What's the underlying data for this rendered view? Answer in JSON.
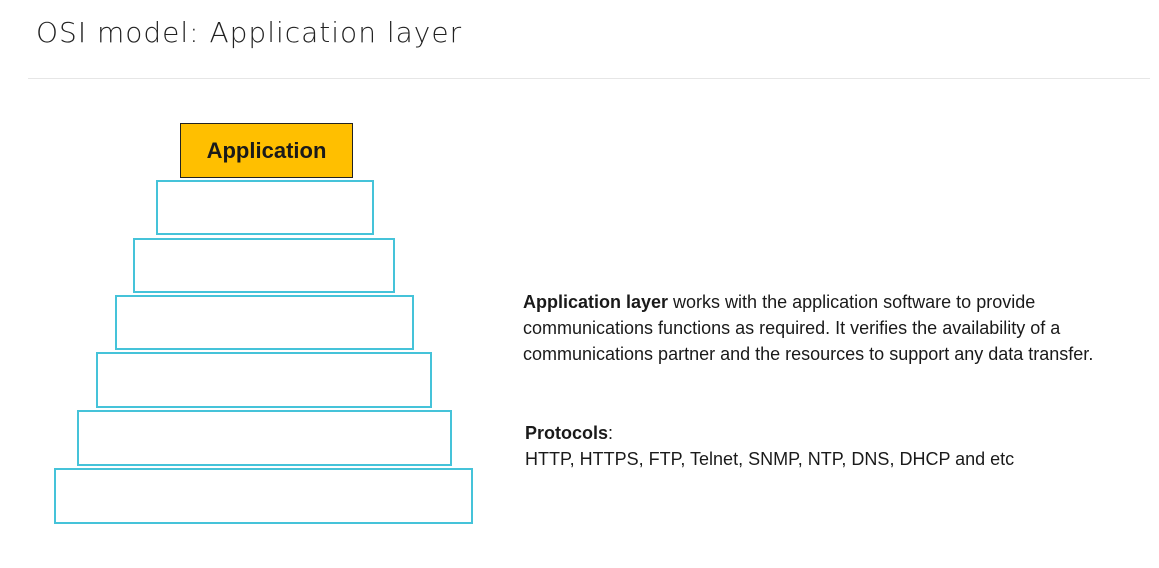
{
  "slide": {
    "title": "OSI model: Application layer"
  },
  "pyramid": {
    "layers": [
      {
        "label": "Application",
        "highlighted": true
      },
      {
        "label": "",
        "highlighted": false
      },
      {
        "label": "",
        "highlighted": false
      },
      {
        "label": "",
        "highlighted": false
      },
      {
        "label": "",
        "highlighted": false
      },
      {
        "label": "",
        "highlighted": false
      },
      {
        "label": "",
        "highlighted": false
      }
    ]
  },
  "description": {
    "term": "Application layer",
    "body": " works with the application software to provide communications functions as required. It verifies the availability of a communications partner and the resources to support any data transfer."
  },
  "protocols": {
    "heading": "Protocols",
    "separator": ":",
    "list": "HTTP, HTTPS, FTP, Telnet, SNMP, NTP, DNS, DHCP and etc"
  },
  "colors": {
    "highlight_fill": "#ffbf00",
    "layer_border": "#45c3d9"
  }
}
